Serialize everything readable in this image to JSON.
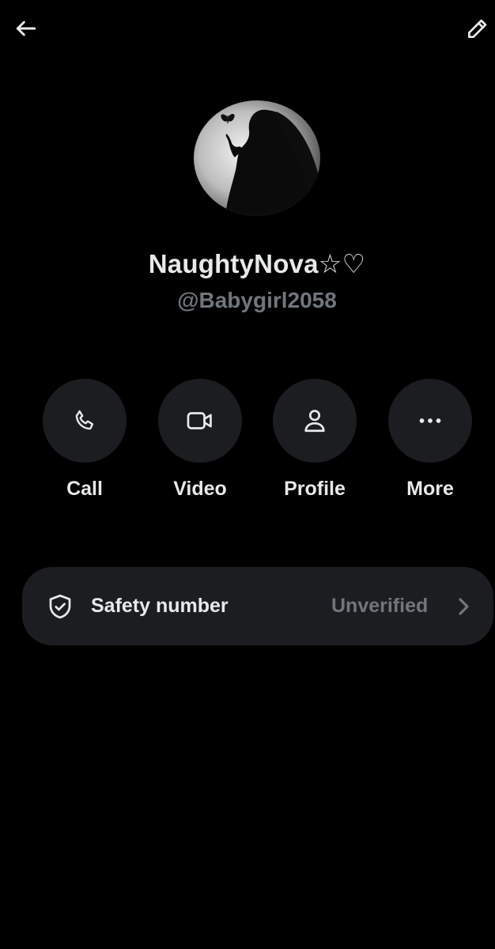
{
  "header": {
    "back_icon": "arrow-left-icon",
    "edit_icon": "pencil-icon"
  },
  "profile": {
    "display_name": "NaughtyNova☆♡",
    "handle": "@Babygirl2058"
  },
  "actions": [
    {
      "icon": "phone-icon",
      "label": "Call"
    },
    {
      "icon": "video-camera-icon",
      "label": "Video"
    },
    {
      "icon": "person-icon",
      "label": "Profile"
    },
    {
      "icon": "more-horizontal-icon",
      "label": "More"
    }
  ],
  "safety": {
    "icon": "shield-check-icon",
    "title": "Safety number",
    "status": "Unverified",
    "chevron_icon": "chevron-right-icon"
  },
  "colors": {
    "background": "#000000",
    "primary_text": "#e7e9ea",
    "secondary_text": "#71767b",
    "surface": "#1c1d21"
  }
}
